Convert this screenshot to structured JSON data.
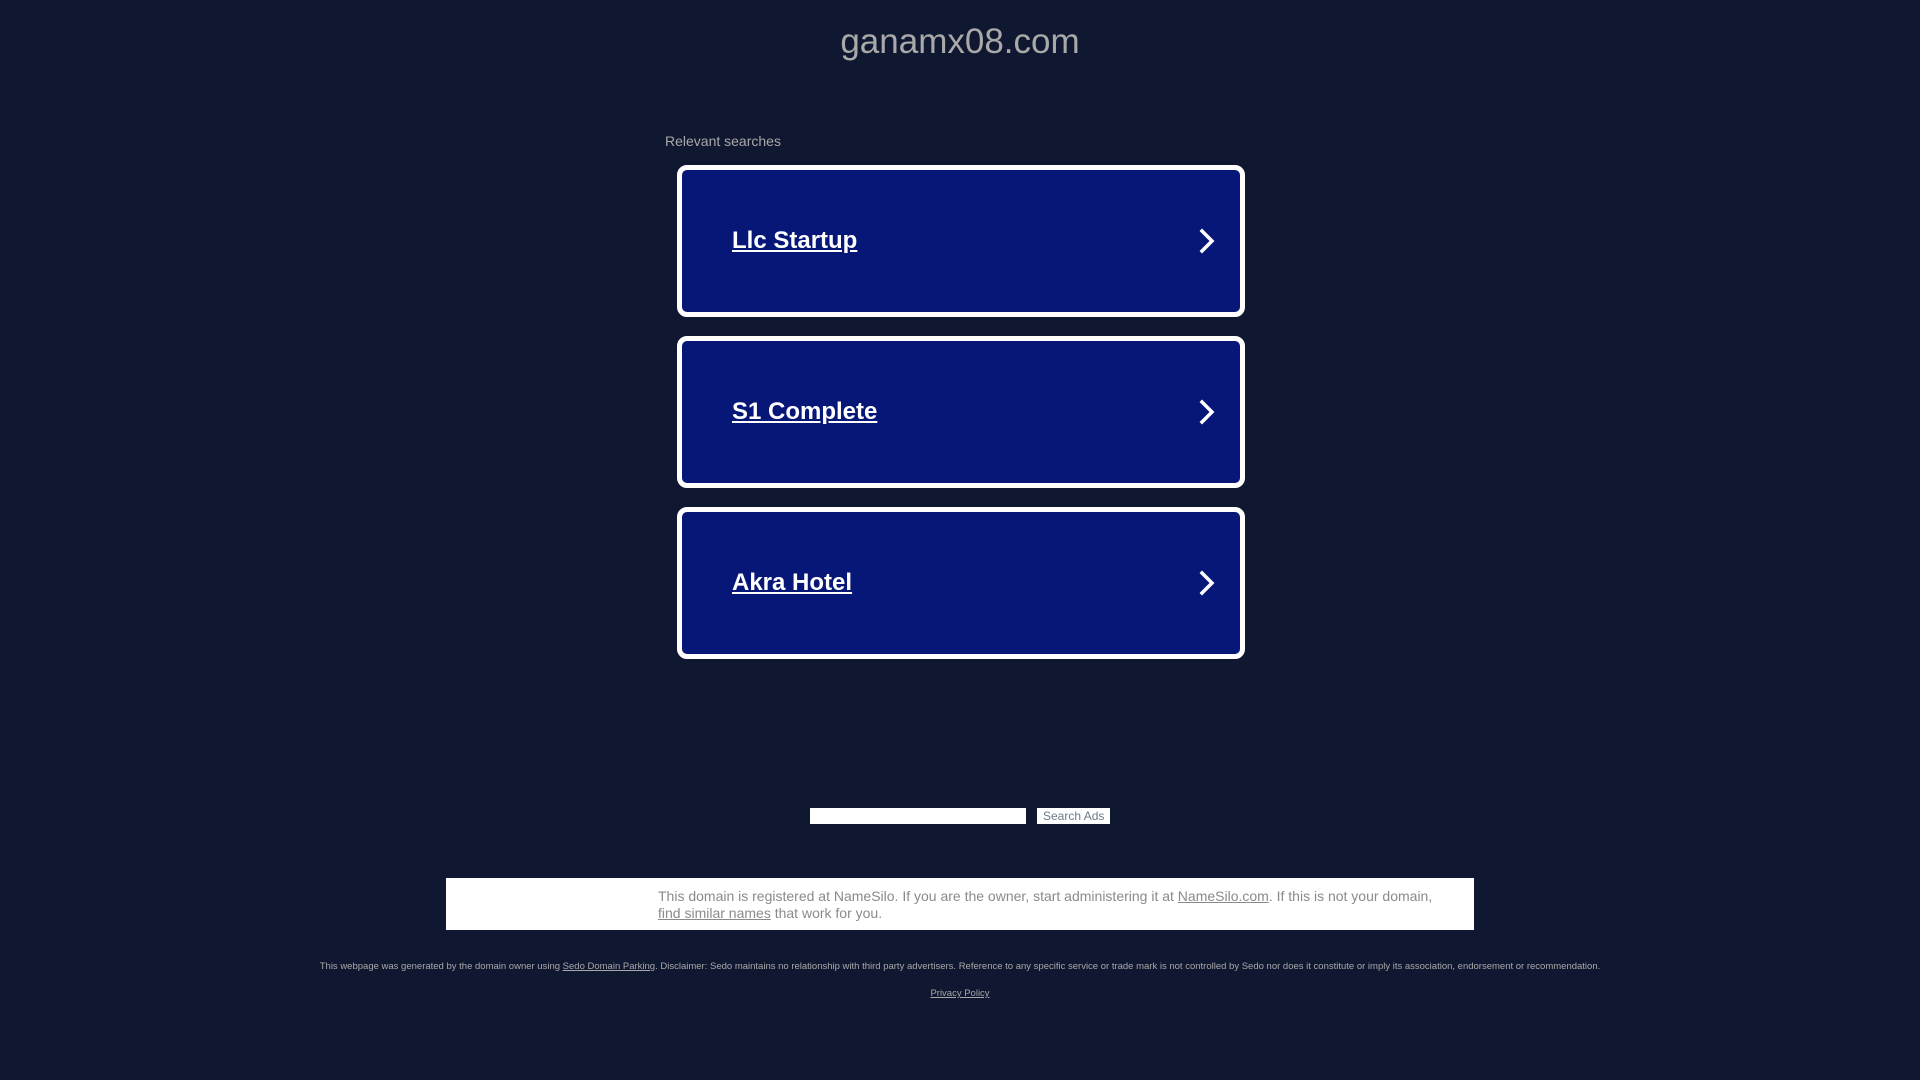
{
  "header": {
    "domain": "ganamx08.com"
  },
  "searches": {
    "label": "Relevant searches",
    "items": [
      {
        "label": "Llc Startup"
      },
      {
        "label": "S1 Complete"
      },
      {
        "label": "Akra Hotel"
      }
    ]
  },
  "search": {
    "value": "",
    "button_label": "Search Ads"
  },
  "registrar": {
    "text_1": "This domain is registered at NameSilo. If you are the owner, start administering it at ",
    "link_1": "NameSilo.com",
    "text_2": ". If this is not your domain, ",
    "link_2": "find similar names",
    "text_3": " that work for you."
  },
  "footer": {
    "disclaimer_prefix": "This webpage was generated by the domain owner using ",
    "disclaimer_link": "Sedo Domain Parking",
    "disclaimer_suffix": ". Disclaimer: Sedo maintains no relationship with third party advertisers. Reference to any specific service or trade mark is not controlled by Sedo nor does it constitute or imply its association, endorsement or recommendation.",
    "privacy_label": "Privacy Policy"
  },
  "colors": {
    "background": "#101730",
    "card_fill": "#061777",
    "card_border": "#ffffff",
    "muted_text": "#a9a9a9"
  }
}
